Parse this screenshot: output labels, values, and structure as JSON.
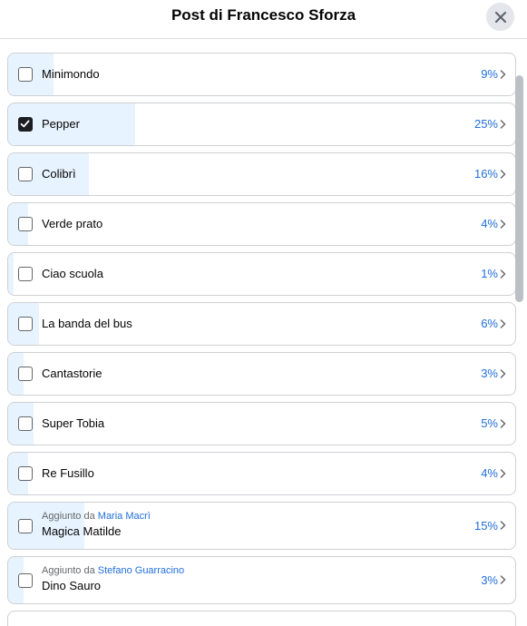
{
  "dialog": {
    "title": "Post di Francesco Sforza",
    "close_icon": "close-icon"
  },
  "colors": {
    "accent": "#216fdb",
    "fill": "#e7f3ff",
    "border": "#ced0d4"
  },
  "options": [
    {
      "label": "Minimondo",
      "percent": "9%",
      "fraction": 0.09,
      "checked": false
    },
    {
      "label": "Pepper",
      "percent": "25%",
      "fraction": 0.25,
      "checked": true
    },
    {
      "label": "Colibrì",
      "percent": "16%",
      "fraction": 0.16,
      "checked": false
    },
    {
      "label": "Verde prato",
      "percent": "4%",
      "fraction": 0.04,
      "checked": false
    },
    {
      "label": "Ciao scuola",
      "percent": "1%",
      "fraction": 0.01,
      "checked": false
    },
    {
      "label": "La banda del bus",
      "percent": "6%",
      "fraction": 0.06,
      "checked": false
    },
    {
      "label": "Cantastorie",
      "percent": "3%",
      "fraction": 0.03,
      "checked": false
    },
    {
      "label": "Super Tobia",
      "percent": "5%",
      "fraction": 0.05,
      "checked": false
    },
    {
      "label": "Re Fusillo",
      "percent": "4%",
      "fraction": 0.04,
      "checked": false
    },
    {
      "label": "Magica Matilde",
      "percent": "15%",
      "fraction": 0.15,
      "checked": false,
      "added_prefix": "Aggiunto da",
      "added_by": "Maria Macrì"
    },
    {
      "label": "Dino Sauro",
      "percent": "3%",
      "fraction": 0.03,
      "checked": false,
      "added_prefix": "Aggiunto da",
      "added_by": "Stefano Guarracino"
    }
  ]
}
